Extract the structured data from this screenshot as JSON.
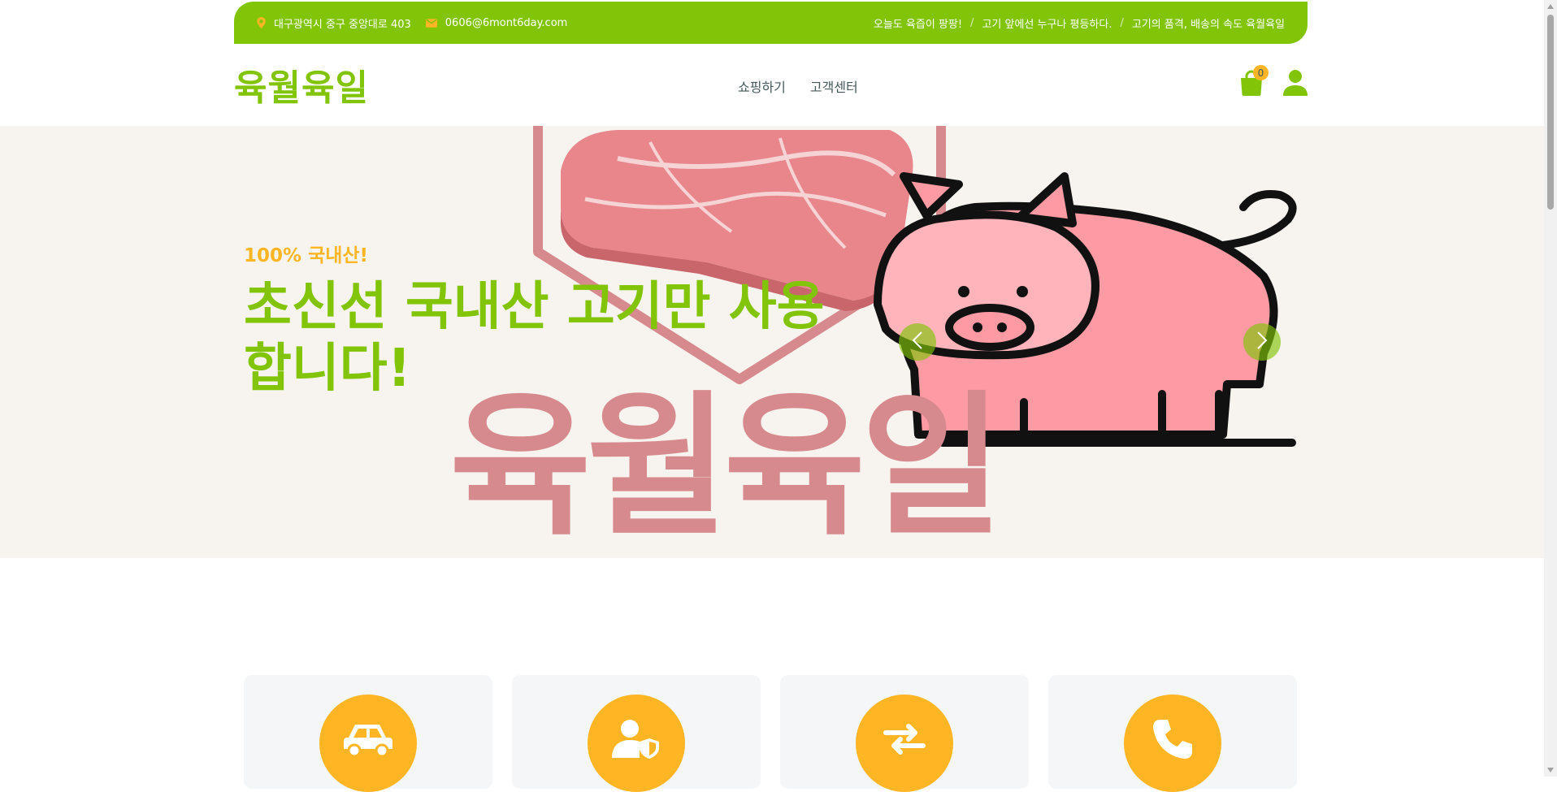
{
  "topbar": {
    "address": "대구광역시 중구 중앙대로 403",
    "email": "0606@6mont6day.com",
    "slogans": [
      "오늘도 육즙이 팡팡!",
      "고기 앞에선 누구나 평등하다.",
      "고기의 품격, 배송의 속도 육월육일"
    ],
    "separator": "/",
    "icons": [
      "map-marker-icon",
      "envelope-icon"
    ]
  },
  "header": {
    "logo": "육월육일",
    "menu": [
      "쇼핑하기",
      "고객센터"
    ],
    "cart_count": "0",
    "icons": [
      "shopping-bag-icon",
      "user-icon"
    ]
  },
  "hero": {
    "subtitle": "100% 국내산!",
    "title": "초신선 국내산 고기만 사용합니다!",
    "watermark": "육월육일",
    "controls": [
      "chevron-left-icon",
      "chevron-right-icon"
    ]
  },
  "features": {
    "icons": [
      "car-icon",
      "user-shield-icon",
      "exchange-arrows-icon",
      "phone-icon"
    ]
  },
  "colors": {
    "brand_green": "#81c408",
    "accent_orange": "#ffb524",
    "hero_bg": "#f7f4ef",
    "meat_pink": "#d78a8e"
  }
}
